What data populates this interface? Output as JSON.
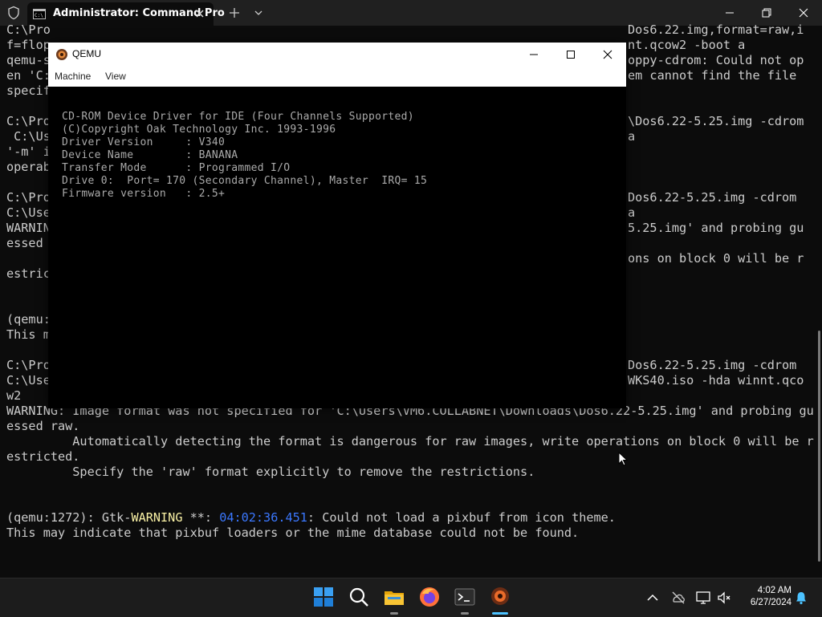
{
  "terminal": {
    "tab_title": "Administrator: Command Pro",
    "lines": [
      {
        "text": "C:\\Pro",
        "row": 0
      },
      {
        "text": "f=flop",
        "row": 1
      },
      {
        "text": "qemu-s",
        "row": 2
      },
      {
        "text": "en 'C:",
        "row": 3
      },
      {
        "text": "specif",
        "row": 4
      },
      {
        "text": "",
        "row": 5
      },
      {
        "text": "C:\\Pro",
        "row": 6
      },
      {
        "text": " C:\\Us",
        "row": 7
      },
      {
        "text": "'-m' i",
        "row": 8
      },
      {
        "text": "operab",
        "row": 9
      },
      {
        "text": "",
        "row": 10
      },
      {
        "text": "C:\\Pro_",
        "row": 11
      },
      {
        "text": "C:\\Use",
        "row": 12
      },
      {
        "text": "WARNIN",
        "row": 13
      },
      {
        "text": "essed ",
        "row": 14
      },
      {
        "text": "",
        "row": 15
      },
      {
        "text": "estric",
        "row": 16
      },
      {
        "text": "",
        "row": 17
      },
      {
        "text": "",
        "row": 18
      },
      {
        "text": "(qemu:",
        "row": 19
      },
      {
        "text": "This m",
        "row": 20
      },
      {
        "text": "",
        "row": 21
      },
      {
        "text": "C:\\Pro",
        "row": 22
      },
      {
        "text": "C:\\Use",
        "row": 23
      },
      {
        "text": "w2",
        "row": 24
      },
      {
        "text": "WARNING: Image format was not specified for 'C:\\Users\\VM6.COLLABNET\\Downloads\\Dos6.22-5.25.img' and probing gu",
        "row": 25
      },
      {
        "text": "essed raw.",
        "row": 26
      },
      {
        "text": "         Automatically detecting the format is dangerous for raw images, write operations on block 0 will be r",
        "row": 27
      },
      {
        "text": "estricted.",
        "row": 28
      },
      {
        "text": "         Specify the 'raw' format explicitly to remove the restrictions.",
        "row": 29
      },
      {
        "text": "",
        "row": 30
      },
      {
        "text": "",
        "row": 32
      },
      {
        "text": "This may indicate that pixbuf loaders or the mime database could not be found.",
        "row": 32
      }
    ],
    "right_lines": [
      {
        "text": "Dos6.22.img,format=raw,i",
        "row": 0
      },
      {
        "text": "nt.qcow2 -boot a",
        "row": 1
      },
      {
        "text": "oppy-cdrom: Could not op",
        "row": 2
      },
      {
        "text": "em cannot find the file",
        "row": 3
      },
      {
        "text": "\\Dos6.22-5.25.img -cdrom",
        "row": 6
      },
      {
        "text": "a",
        "row": 7
      },
      {
        "text": "Dos6.22-5.25.img -cdrom",
        "row": 11
      },
      {
        "text": "a",
        "row": 12
      },
      {
        "text": "5.25.img' and probing gu",
        "row": 13
      },
      {
        "text": "ons on block 0 will be r",
        "row": 15
      },
      {
        "text": "Dos6.22-5.25.img -cdrom",
        "row": 22
      },
      {
        "text": "WKS40.iso -hda winnt.qco",
        "row": 23
      }
    ],
    "gtk_line": {
      "prefix": "(qemu:1272): Gtk-",
      "warning": "WARNING",
      "mid": " **: ",
      "timestamp": "04:02:36.451",
      "suffix": ": Could not load a pixbuf from icon theme."
    },
    "blurred_fragment": "C:\\Users\\VM6.COLLABNET\\Downloads\\..."
  },
  "qemu": {
    "title": "QEMU",
    "menu": [
      "Machine",
      "View"
    ],
    "screen_lines": [
      "CD-ROM Device Driver for IDE (Four Channels Supported)",
      "(C)Copyright Oak Technology Inc. 1993-1996",
      "Driver Version     : V340",
      "Device Name        : BANANA",
      "Transfer Mode      : Programmed I/O",
      "Drive 0:  Port= 170 (Secondary Channel), Master  IRQ= 15",
      "Firmware version   : 2.5+"
    ]
  },
  "taskbar": {
    "apps": [
      "start-icon",
      "search-icon",
      "file-explorer-icon",
      "firefox-icon",
      "terminal-icon",
      "qemu-icon"
    ],
    "clock_time": "4:02 AM",
    "clock_date": "6/27/2024"
  }
}
